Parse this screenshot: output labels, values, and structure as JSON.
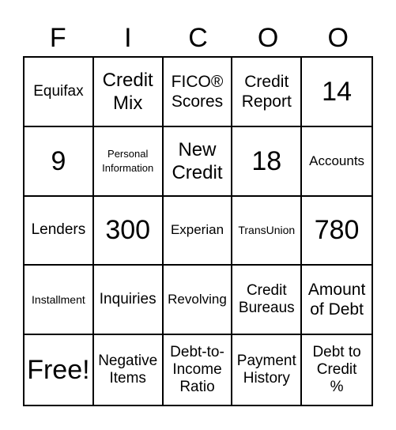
{
  "header": {
    "letters": [
      "F",
      "I",
      "C",
      "O",
      "O"
    ]
  },
  "cells": [
    "Equifax",
    "Credit Mix",
    "FICO® Scores",
    "Credit Report",
    "14",
    "9",
    "Personal Information",
    "New Credit",
    "18",
    "Accounts",
    "Lenders",
    "300",
    "Experian",
    "TransUnion",
    "780",
    "Installment",
    "Inquiries",
    "Revolving",
    "Credit Bureaus",
    "Amount of Debt",
    "Free!",
    "Negative Items",
    "Debt-to-Income Ratio",
    "Payment History",
    "Debt to Credit %"
  ],
  "cell_lines": [
    [
      "Equifax"
    ],
    [
      "Credit",
      "Mix"
    ],
    [
      "FICO®",
      "Scores"
    ],
    [
      "Credit",
      "Report"
    ],
    [
      "14"
    ],
    [
      "9"
    ],
    [
      "Personal",
      "Information"
    ],
    [
      "New",
      "Credit"
    ],
    [
      "18"
    ],
    [
      "Accounts"
    ],
    [
      "Lenders"
    ],
    [
      "300"
    ],
    [
      "Experian"
    ],
    [
      "TransUnion"
    ],
    [
      "780"
    ],
    [
      "Installment"
    ],
    [
      "Inquiries"
    ],
    [
      "Revolving"
    ],
    [
      "Credit",
      "Bureaus"
    ],
    [
      "Amount",
      "of Debt"
    ],
    [
      "Free!"
    ],
    [
      "Negative",
      "Items"
    ],
    [
      "Debt-to-",
      "Income",
      "Ratio"
    ],
    [
      "Payment",
      "History"
    ],
    [
      "Debt to",
      "Credit",
      "%"
    ]
  ],
  "colors": {
    "grid_line": "#000000",
    "background": "#ffffff",
    "text": "#000000"
  }
}
